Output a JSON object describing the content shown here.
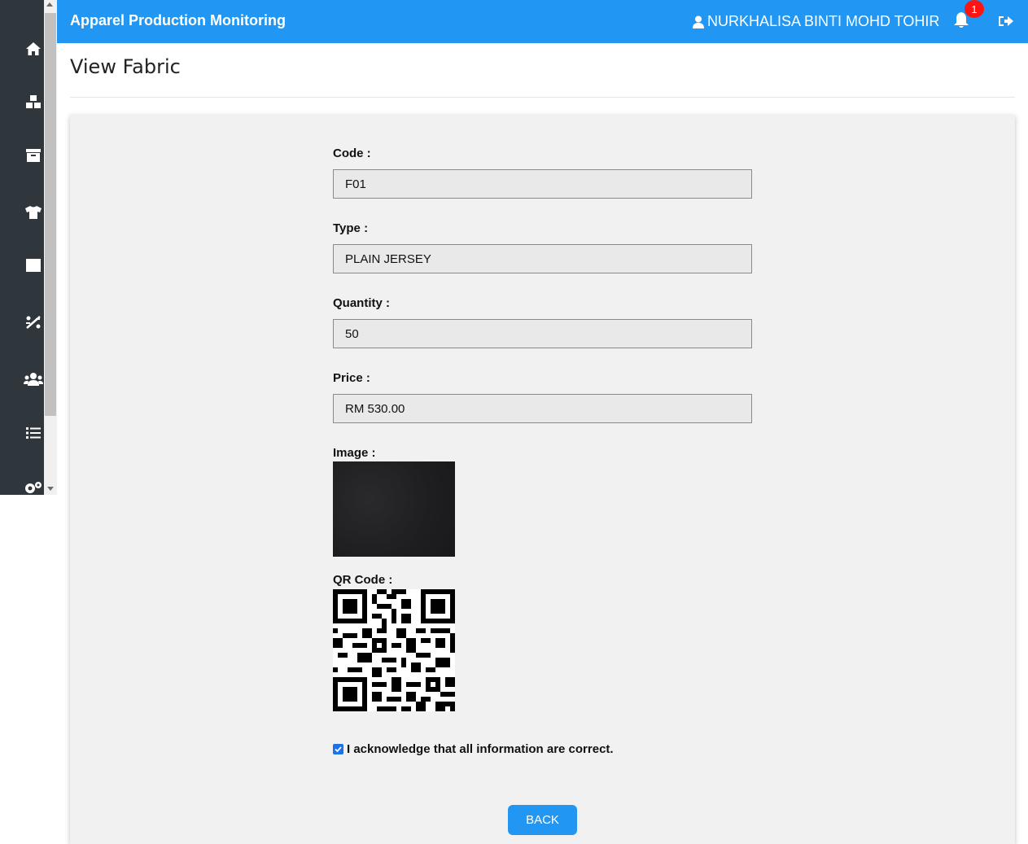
{
  "header": {
    "brand": "Apparel Production Monitoring",
    "user_name": "NURKHALISA BINTI MOHD TOHIR",
    "notification_count": "1",
    "accent_color": "#2196f3",
    "badge_color": "#ff1414"
  },
  "sidebar": {
    "items": [
      {
        "icon": "home-icon"
      },
      {
        "icon": "boxes-icon"
      },
      {
        "icon": "archive-icon"
      },
      {
        "icon": "tshirt-icon"
      },
      {
        "icon": "square-icon"
      },
      {
        "icon": "chart-icon"
      },
      {
        "icon": "users-icon"
      },
      {
        "icon": "list-icon"
      },
      {
        "icon": "settings-icon"
      }
    ]
  },
  "page": {
    "title": "View Fabric"
  },
  "form": {
    "code_label": "Code :",
    "code_value": "F01",
    "type_label": "Type :",
    "type_value": "PLAIN JERSEY",
    "quantity_label": "Quantity :",
    "quantity_value": "50",
    "price_label": "Price :",
    "price_value": "RM 530.00",
    "image_label": "Image :",
    "qr_label": "QR Code :",
    "ack_text": "I acknowledge that all information are correct.",
    "ack_checked": true,
    "back_label": "BACK"
  }
}
